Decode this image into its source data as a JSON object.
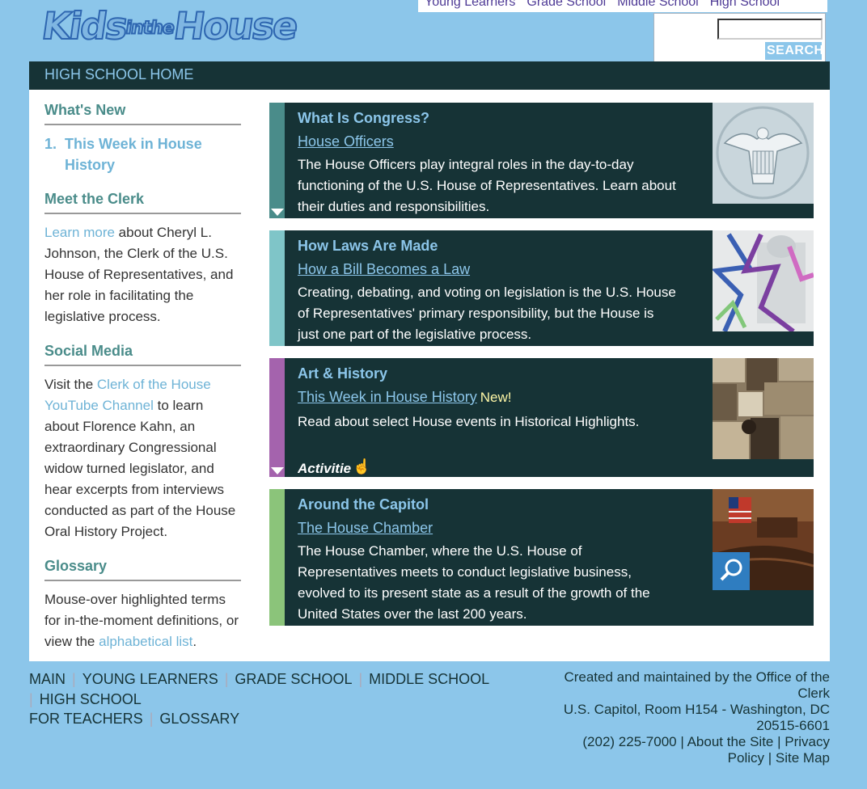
{
  "header": {
    "logo_alt": "Kids in the House",
    "logo_parts": [
      "Kids",
      "in",
      "the",
      "House"
    ],
    "top_nav": [
      "Young Learners",
      "Grade School",
      "Middle School",
      "High School"
    ],
    "search_button": "SEARCH"
  },
  "title_bar": "HIGH SCHOOL HOME",
  "sidebar": {
    "whats_new": {
      "heading": "What's New",
      "items": [
        {
          "num": "1.",
          "label": "This Week in House History"
        }
      ]
    },
    "meet_clerk": {
      "heading": "Meet the Clerk",
      "link": "Learn more",
      "text": "about Cheryl L. Johnson, the Clerk of the U.S. House of Representatives, and her role in facilitating the legislative process."
    },
    "social_media": {
      "heading": "Social Media",
      "pre": "Visit the",
      "link": "Clerk of the House YouTube Channel",
      "text": "to learn about Florence Kahn, an extraordinary Congressional widow turned legislator, and hear excerpts from interviews conducted as part of the House Oral History Project."
    },
    "glossary": {
      "heading": "Glossary",
      "text": "Mouse-over highlighted terms for in-the-moment definitions, or view the",
      "link": "alphabetical list",
      "post": "."
    }
  },
  "panels": [
    {
      "title": "What Is Congress?",
      "link": "House Officers",
      "text": "The House Officers play integral roles in the day-to-day functioning of the U.S. House of Representatives. Learn about their duties and responsibilities.",
      "stripe_color": "#4a8c8a"
    },
    {
      "title": "How Laws Are Made",
      "link": "How a Bill Becomes a Law",
      "text": "Creating, debating, and voting on legislation is the U.S. House of Representatives' primary responsibility, but the House is just one part of the legislative process.",
      "stripe_color": "#7fc5c8"
    },
    {
      "title": "Art & History",
      "link": "This Week in House History",
      "badge": "New!",
      "text": "Read about select House events in Historical Highlights.",
      "extra": "Activities",
      "stripe_color": "#a463ad"
    },
    {
      "title": "Around the Capitol",
      "link": "The House Chamber",
      "text": "The House Chamber, where the U.S. House of Representatives meets to conduct legislative business, evolved to its present state as a result of the growth of the United States over the last 200 years.",
      "stripe_color": "#8bc47a"
    }
  ],
  "footer": {
    "nav_row1": [
      "MAIN",
      "YOUNG LEARNERS",
      "GRADE SCHOOL",
      "MIDDLE SCHOOL"
    ],
    "nav_row2": [
      "HIGH SCHOOL"
    ],
    "nav_row3": [
      "FOR TEACHERS",
      "GLOSSARY"
    ],
    "info_line1": "Created and maintained by the Office of the Clerk",
    "info_line2": "U.S. Capitol, Room H154 - Washington, DC 20515-6601",
    "phone": "(202) 225-7000",
    "about": "About the Site",
    "privacy": "Privacy Policy",
    "sitemap": "Site Map"
  }
}
